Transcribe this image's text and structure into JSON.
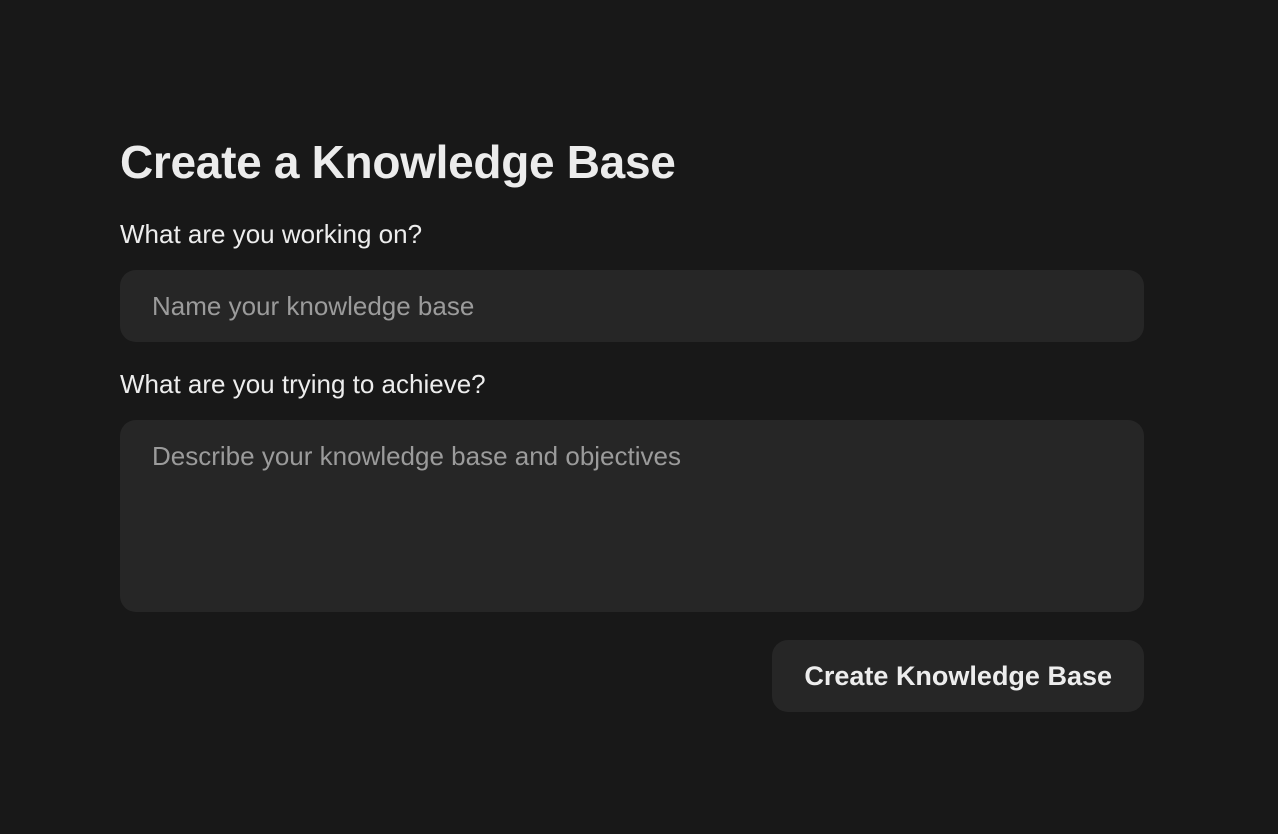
{
  "page": {
    "title": "Create a Knowledge Base"
  },
  "form": {
    "name_label": "What are you working on?",
    "name_value": "",
    "name_placeholder": "Name your knowledge base",
    "description_label": "What are you trying to achieve?",
    "description_value": "",
    "description_placeholder": "Describe your knowledge base and objectives",
    "submit_label": "Create Knowledge Base"
  },
  "colors": {
    "background": "#181818",
    "field_background": "#262626",
    "text": "#ededed",
    "placeholder": "#9b9b9b"
  }
}
